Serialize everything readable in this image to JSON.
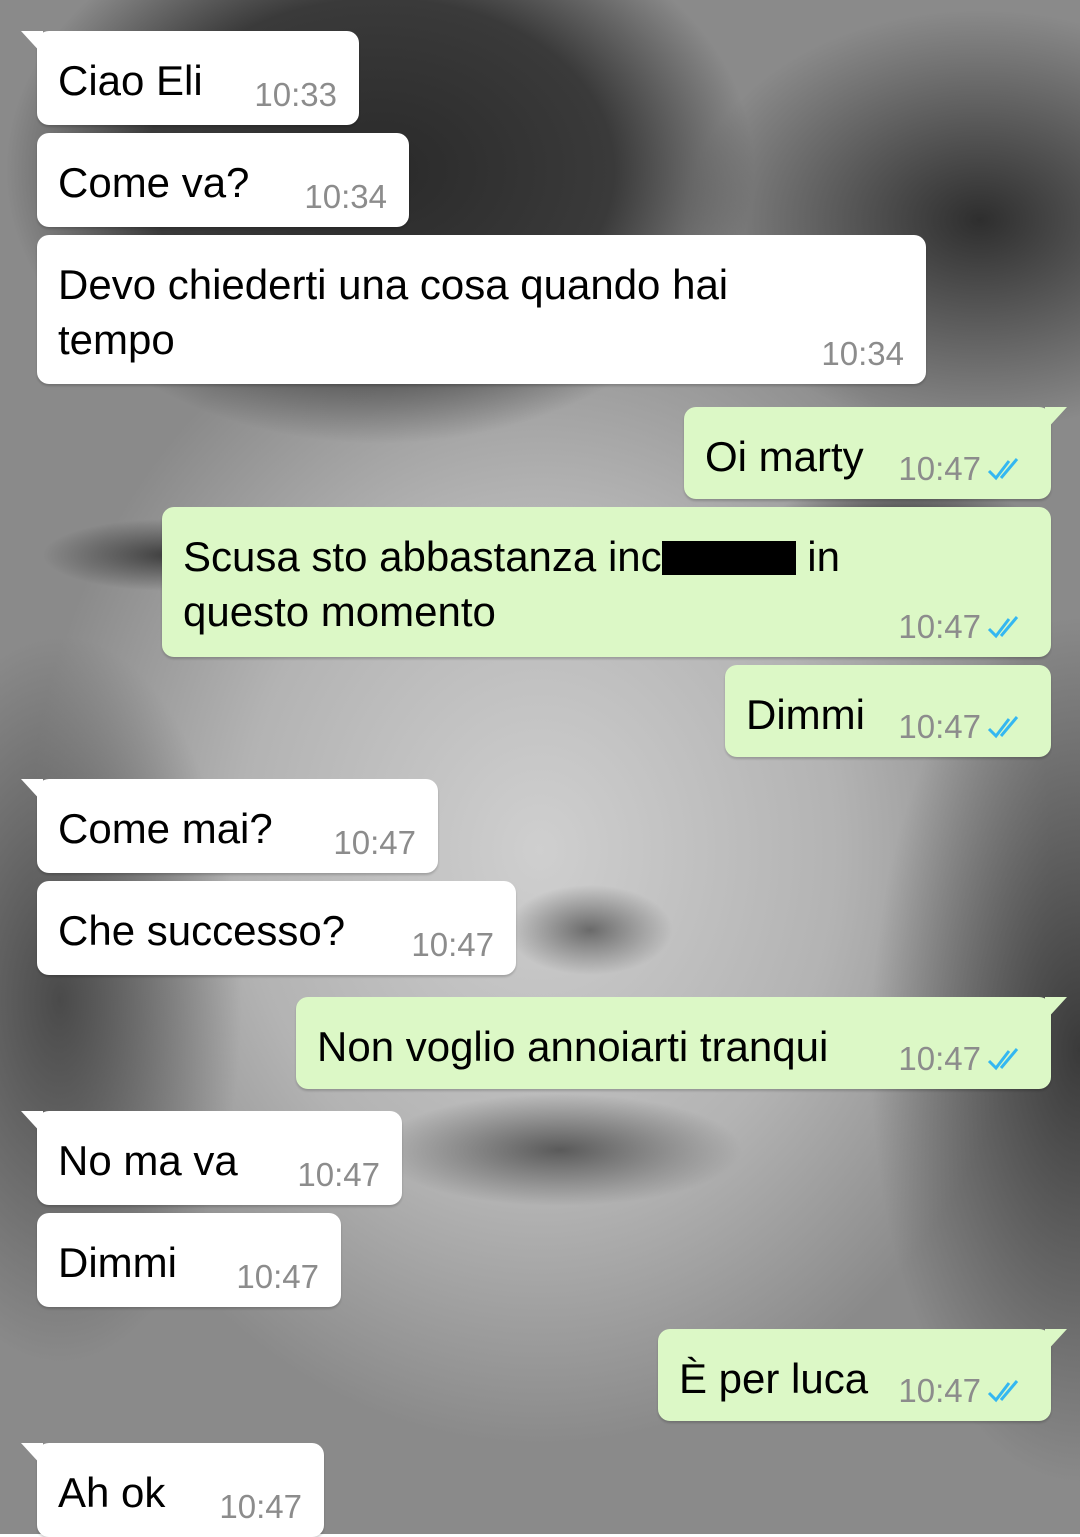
{
  "messages": [
    {
      "dir": "in",
      "tail": true,
      "text": "Ciao Eli",
      "time": "10:33"
    },
    {
      "dir": "in",
      "tail": false,
      "text": "Come va?",
      "time": "10:34"
    },
    {
      "dir": "in",
      "tail": false,
      "text": "Devo chiederti una cosa quando hai tempo",
      "time": "10:34"
    },
    {
      "dir": "out",
      "tail": true,
      "text": "Oi marty",
      "time": "10:47",
      "status": "read"
    },
    {
      "dir": "out",
      "tail": false,
      "text_before": "Scusa sto abbastanza inc",
      "text_after": " in questo momento",
      "redacted": true,
      "time": "10:47",
      "status": "read"
    },
    {
      "dir": "out",
      "tail": false,
      "text": "Dimmi",
      "time": "10:47",
      "status": "read"
    },
    {
      "dir": "in",
      "tail": true,
      "text": "Come mai?",
      "time": "10:47"
    },
    {
      "dir": "in",
      "tail": false,
      "text": "Che successo?",
      "time": "10:47"
    },
    {
      "dir": "out",
      "tail": true,
      "text": "Non voglio annoiarti tranqui",
      "time": "10:47",
      "status": "read"
    },
    {
      "dir": "in",
      "tail": true,
      "text": "No ma va",
      "time": "10:47"
    },
    {
      "dir": "in",
      "tail": false,
      "text": "Dimmi",
      "time": "10:47"
    },
    {
      "dir": "out",
      "tail": true,
      "text": "È per luca",
      "time": "10:47",
      "status": "read"
    },
    {
      "dir": "in",
      "tail": true,
      "text": "Ah ok",
      "time": "10:47"
    }
  ],
  "colors": {
    "incoming": "#ffffff",
    "outgoing": "#dcf8c6",
    "time": "#8c8c8c",
    "read_check": "#34b7f1",
    "redaction": "#000000"
  },
  "icons": {
    "read_receipt": "double-check-icon"
  }
}
